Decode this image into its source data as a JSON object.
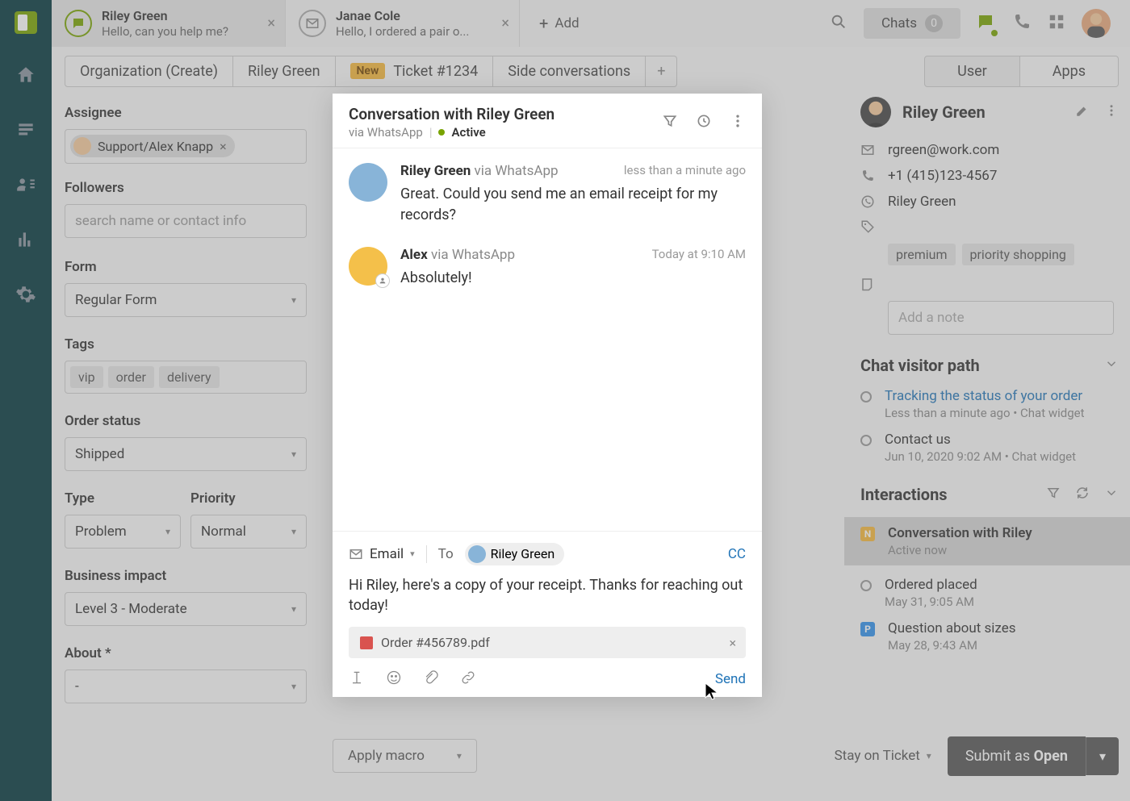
{
  "tabs": [
    {
      "name": "Riley Green",
      "preview": "Hello, can you help me?"
    },
    {
      "name": "Janae Cole",
      "preview": "Hello, I ordered a pair o..."
    }
  ],
  "addTab": "Add",
  "chats": {
    "label": "Chats",
    "count": "0"
  },
  "breadcrumbs": {
    "org": "Organization (Create)",
    "requester": "Riley Green",
    "newBadge": "New",
    "ticket": "Ticket #1234",
    "side": "Side conversations"
  },
  "rightSeg": {
    "user": "User",
    "apps": "Apps"
  },
  "leftForm": {
    "assigneeLabel": "Assignee",
    "assignee": "Support/Alex Knapp",
    "followersLabel": "Followers",
    "followersPlaceholder": "search name or contact info",
    "formLabel": "Form",
    "form": "Regular Form",
    "tagsLabel": "Tags",
    "tags": [
      "vip",
      "order",
      "delivery"
    ],
    "orderStatusLabel": "Order status",
    "orderStatus": "Shipped",
    "typeLabel": "Type",
    "type": "Problem",
    "priorityLabel": "Priority",
    "priority": "Normal",
    "bizLabel": "Business impact",
    "biz": "Level 3 - Moderate",
    "aboutLabel": "About *",
    "about": "-"
  },
  "convo": {
    "title": "Conversation with Riley Green",
    "via": "via WhatsApp",
    "status": "Active",
    "messages": [
      {
        "who": "Riley Green",
        "via": "via WhatsApp",
        "ts": "less than a minute ago",
        "body": "Great. Could you send me an email receipt for my records?"
      },
      {
        "who": "Alex",
        "via": "via WhatsApp",
        "ts": "Today at 9:10 AM",
        "body": "Absolutely!"
      }
    ],
    "composer": {
      "channel": "Email",
      "toLabel": "To",
      "recipient": "Riley Green",
      "cc": "CC",
      "body": "Hi Riley, here's a copy of your receipt. Thanks for reaching out today!",
      "attachment": "Order #456789.pdf",
      "send": "Send"
    }
  },
  "user": {
    "name": "Riley Green",
    "email": "rgreen@work.com",
    "phone": "+1 (415)123-4567",
    "whatsapp": "Riley Green",
    "tags": [
      "premium",
      "priority shopping"
    ],
    "notePlaceholder": "Add a note"
  },
  "visitorPath": {
    "title": "Chat visitor path",
    "items": [
      {
        "l1": "Tracking the status of your order",
        "l2": "Less than a minute ago • Chat widget",
        "link": true
      },
      {
        "l1": "Contact us",
        "l2": "Jun 10, 2020 9:02 AM • Chat widget",
        "link": false
      }
    ]
  },
  "interactions": {
    "title": "Interactions",
    "items": [
      {
        "badge": "N",
        "l1": "Conversation with Riley",
        "l2": "Active now",
        "active": true
      },
      {
        "badge": "",
        "l1": "Ordered placed",
        "l2": "May 31, 9:05 AM"
      },
      {
        "badge": "P",
        "l1": "Question about sizes",
        "l2": "May 28, 9:43 AM"
      }
    ]
  },
  "bottom": {
    "macro": "Apply macro",
    "stay": "Stay on Ticket",
    "submit": "Submit as ",
    "submitStatus": "Open"
  }
}
